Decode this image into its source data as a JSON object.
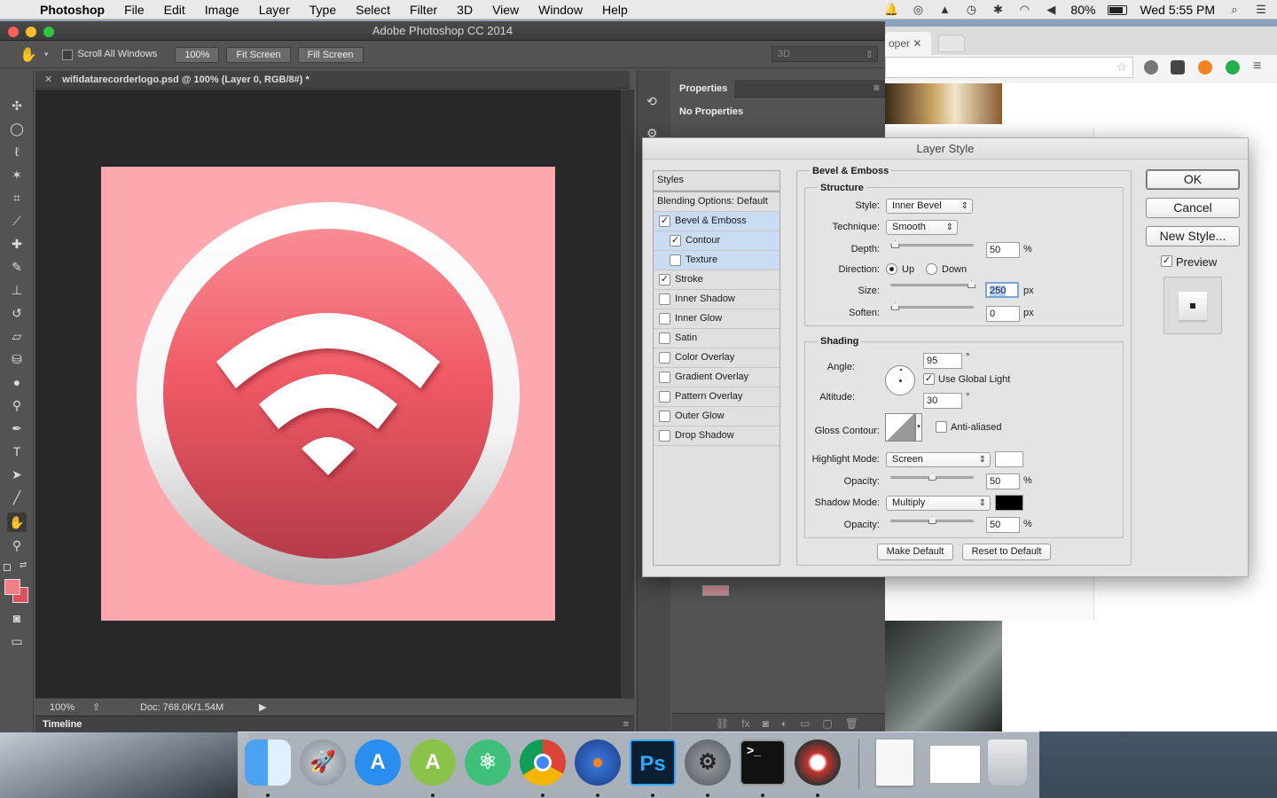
{
  "menubar": {
    "app_name": "Photoshop",
    "items": [
      "File",
      "Edit",
      "Image",
      "Layer",
      "Type",
      "Select",
      "Filter",
      "3D",
      "View",
      "Window",
      "Help"
    ],
    "battery": "80%",
    "clock": "Wed 5:55 PM"
  },
  "browser": {
    "tab_label": "oper"
  },
  "photoshop": {
    "window_title": "Adobe Photoshop CC 2014",
    "options": {
      "scroll_all_windows": "Scroll All Windows",
      "zoom_100": "100%",
      "fit_screen": "Fit Screen",
      "fill_screen": "Fill Screen",
      "mode_3d": "3D"
    },
    "document_tab": "wifidatarecorderlogo.psd @ 100% (Layer 0, RGB/8#) *",
    "status": {
      "zoom": "100%",
      "doc_size": "Doc: 768.0K/1.54M"
    },
    "timeline_label": "Timeline",
    "properties": {
      "tab": "Properties",
      "content": "No Properties"
    },
    "canvas_bg": "#fda8ae",
    "accent": "#e0505a"
  },
  "dialog": {
    "title": "Layer Style",
    "styles_header": "Styles",
    "blending_options": "Blending Options: Default",
    "effects": [
      {
        "label": "Bevel & Emboss",
        "checked": true,
        "sub": false,
        "highlight": true
      },
      {
        "label": "Contour",
        "checked": true,
        "sub": true,
        "highlight": true
      },
      {
        "label": "Texture",
        "checked": false,
        "sub": true,
        "highlight": true
      },
      {
        "label": "Stroke",
        "checked": true,
        "sub": false,
        "highlight": false
      },
      {
        "label": "Inner Shadow",
        "checked": false,
        "sub": false,
        "highlight": false
      },
      {
        "label": "Inner Glow",
        "checked": false,
        "sub": false,
        "highlight": false
      },
      {
        "label": "Satin",
        "checked": false,
        "sub": false,
        "highlight": false
      },
      {
        "label": "Color Overlay",
        "checked": false,
        "sub": false,
        "highlight": false
      },
      {
        "label": "Gradient Overlay",
        "checked": false,
        "sub": false,
        "highlight": false
      },
      {
        "label": "Pattern Overlay",
        "checked": false,
        "sub": false,
        "highlight": false
      },
      {
        "label": "Outer Glow",
        "checked": false,
        "sub": false,
        "highlight": false
      },
      {
        "label": "Drop Shadow",
        "checked": false,
        "sub": false,
        "highlight": false
      }
    ],
    "bevel": {
      "group_title": "Bevel & Emboss",
      "structure_title": "Structure",
      "style_label": "Style:",
      "style_value": "Inner Bevel",
      "technique_label": "Technique:",
      "technique_value": "Smooth",
      "depth_label": "Depth:",
      "depth_value": "50",
      "depth_unit": "%",
      "direction_label": "Direction:",
      "direction_up": "Up",
      "direction_down": "Down",
      "size_label": "Size:",
      "size_value": "250",
      "size_unit": "px",
      "soften_label": "Soften:",
      "soften_value": "0",
      "soften_unit": "px"
    },
    "shading": {
      "title": "Shading",
      "angle_label": "Angle:",
      "angle_value": "95",
      "degree": "°",
      "use_global_light": "Use Global Light",
      "altitude_label": "Altitude:",
      "altitude_value": "30",
      "gloss_label": "Gloss Contour:",
      "anti_aliased": "Anti-aliased",
      "highlight_mode_label": "Highlight Mode:",
      "highlight_mode_value": "Screen",
      "highlight_color": "#ffffff",
      "opacity_label": "Opacity:",
      "highlight_opacity": "50",
      "shadow_mode_label": "Shadow Mode:",
      "shadow_mode_value": "Multiply",
      "shadow_color": "#000000",
      "shadow_opacity": "50",
      "percent": "%"
    },
    "make_default": "Make Default",
    "reset_default": "Reset to Default",
    "ok": "OK",
    "cancel": "Cancel",
    "new_style": "New Style...",
    "preview": "Preview"
  },
  "dock": {
    "apps": [
      "Finder",
      "Launchpad",
      "App Store",
      "Android Studio",
      "Atom",
      "Chrome",
      "Firefox",
      "Photoshop",
      "System Preferences",
      "Terminal",
      "Pixelmator",
      "Document",
      "Preview",
      "Trash"
    ]
  }
}
